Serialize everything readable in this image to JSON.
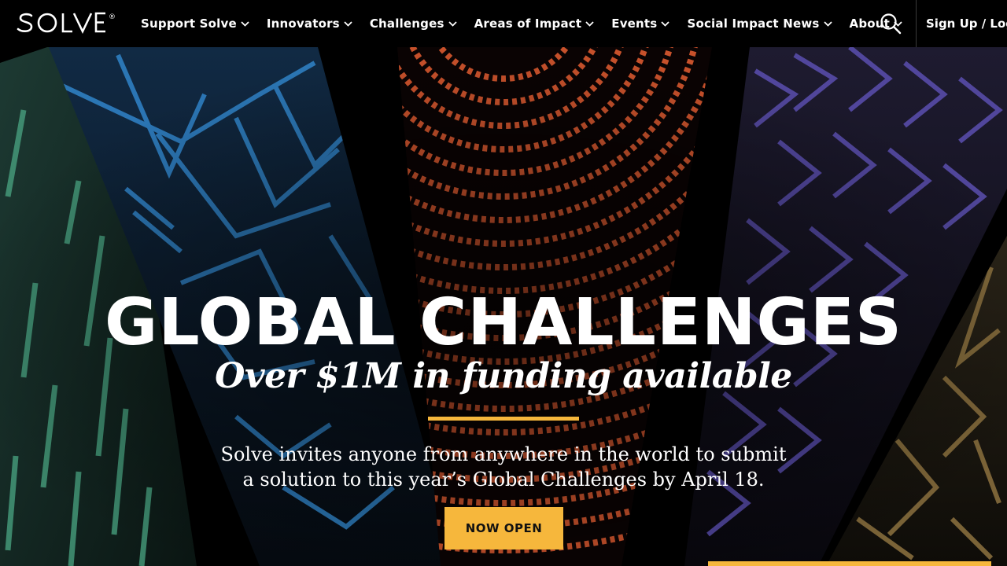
{
  "brand": {
    "name": "SOLVE",
    "registered_mark": "®"
  },
  "nav": {
    "items": [
      {
        "label": "Support Solve"
      },
      {
        "label": "Innovators"
      },
      {
        "label": "Challenges"
      },
      {
        "label": "Areas of Impact"
      },
      {
        "label": "Events"
      },
      {
        "label": "Social Impact News"
      },
      {
        "label": "About"
      }
    ],
    "search_icon": "search-icon",
    "signup_label": "Sign Up / Log"
  },
  "hero": {
    "title": "GLOBAL CHALLENGES",
    "subtitle": "Over $1M in funding available",
    "description": "Solve invites anyone from anywhere in the world to submit a solution to this year’s Global Challenges by April 18.",
    "cta_label": "NOW OPEN"
  },
  "colors": {
    "accent": "#f6b73c",
    "background": "#000000",
    "panel_green": "#3f8f6e",
    "panel_blue": "#2c78b8",
    "panel_orange": "#d2562e",
    "panel_purple": "#6456b8",
    "panel_gold": "#a68645"
  }
}
